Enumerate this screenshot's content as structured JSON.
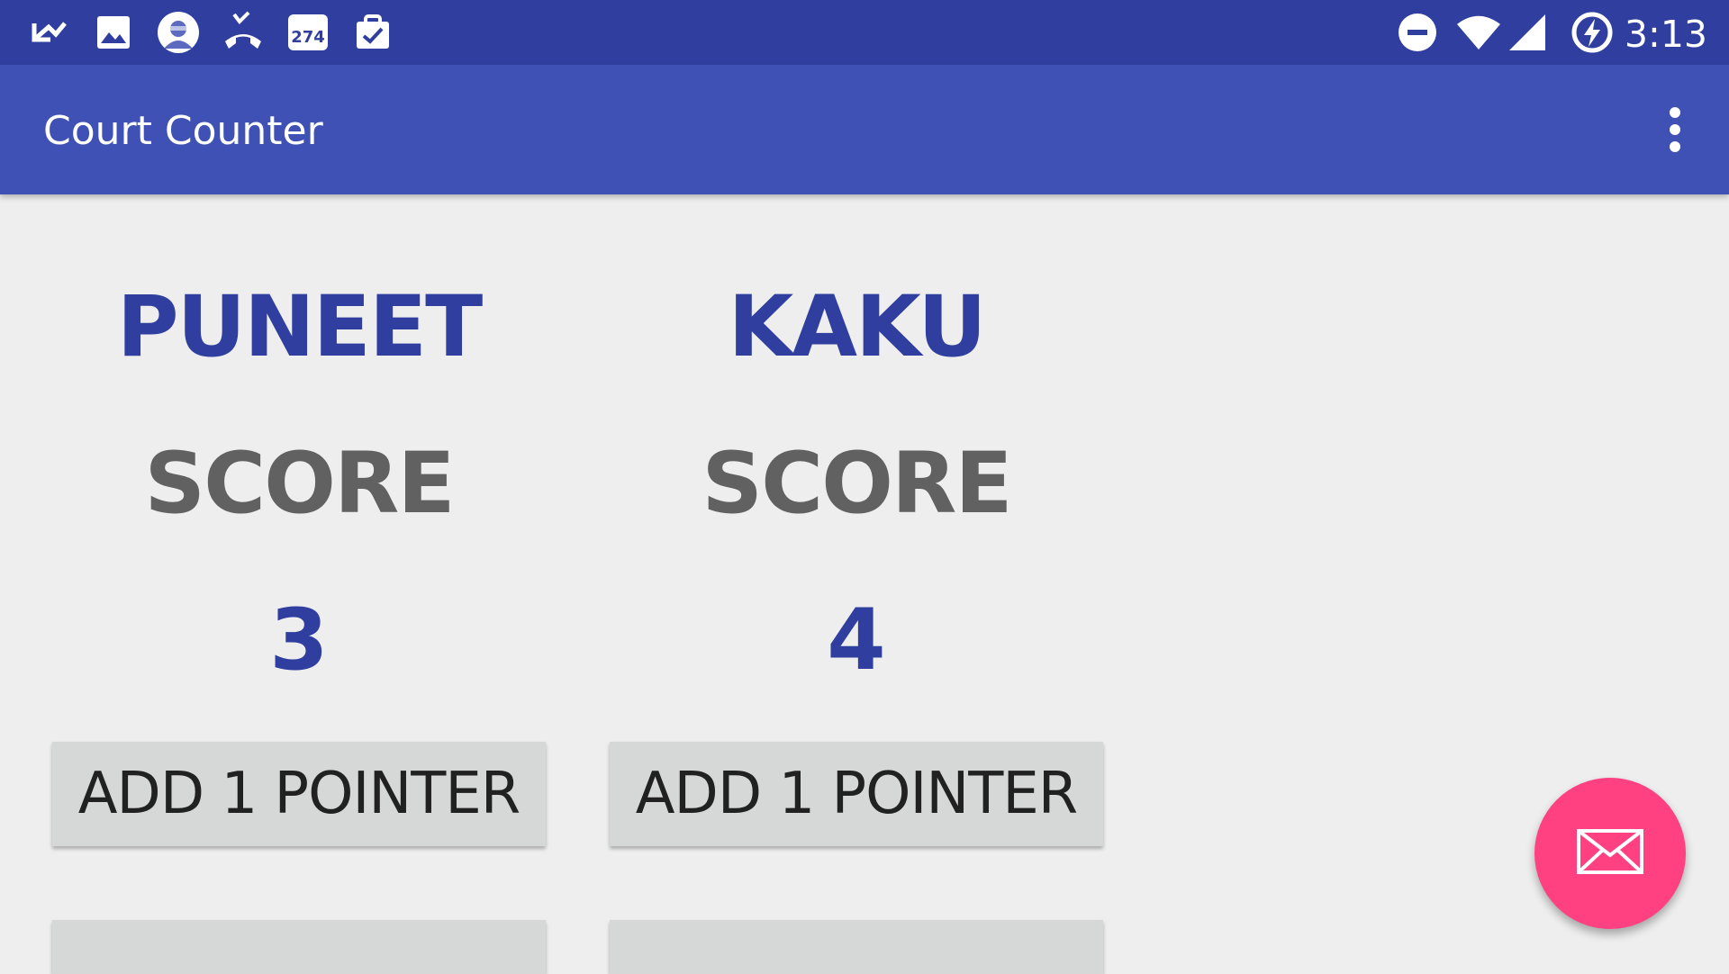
{
  "status_bar": {
    "time": "3:13",
    "left_icons": [
      "missed-call-arrow-icon",
      "image-icon",
      "avatar-icon",
      "call-end-icon",
      "calendar-badge-icon",
      "clipboard-check-icon"
    ],
    "calendar_badge": "274",
    "right_icons": [
      "do-not-disturb-icon",
      "wifi-icon",
      "cell-signal-icon",
      "battery-charging-icon"
    ]
  },
  "app_bar": {
    "title": "Court Counter",
    "menu_icon": "more-vert-icon"
  },
  "teams": [
    {
      "name": "PUNEET",
      "score_label": "SCORE",
      "score": "3",
      "button_label": "ADD 1 POINTER"
    },
    {
      "name": "KAKU",
      "score_label": "SCORE",
      "score": "4",
      "button_label": "ADD 1 POINTER"
    }
  ],
  "fab": {
    "icon": "mail-icon"
  },
  "colors": {
    "status_bar": "#303f9f",
    "app_bar": "#3f51b5",
    "background": "#eeeeee",
    "team_name": "#303f9f",
    "score_label": "#616161",
    "button": "#d6d7d7",
    "fab": "#ff4081"
  }
}
